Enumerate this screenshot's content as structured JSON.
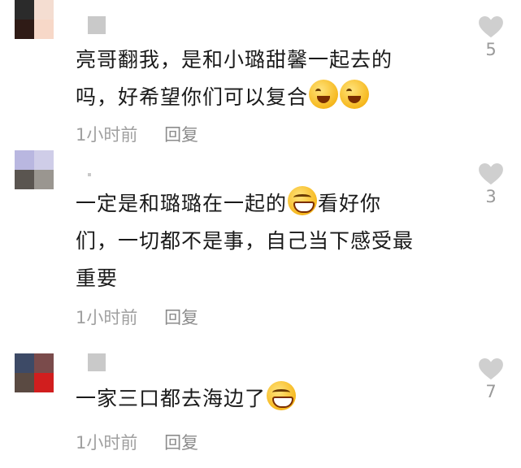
{
  "comments": [
    {
      "text_lines": [
        "亮哥翻我，是和小璐甜馨一起去的",
        "吗，好希望你们可以复合"
      ],
      "emoji": [
        "wink-laugh-emoji",
        "wink-laugh-emoji"
      ],
      "time": "1小时前",
      "reply": "回复",
      "likes": "5",
      "avatar_colors": [
        "#2b2b2b",
        "#f4ddd1",
        "#2f1b16",
        "#f7d8c8"
      ]
    },
    {
      "text_lines": [
        "一定是和璐璐在一起的",
        "看好你",
        "们，一切都不是事，自己当下感受最",
        "重要"
      ],
      "emoji": [
        "grin-emoji"
      ],
      "time": "1小时前",
      "reply": "回复",
      "likes": "3",
      "avatar_colors": [
        "#b9b7e0",
        "#cfcde8",
        "#5a5550",
        "#9a9690"
      ]
    },
    {
      "text_lines": [
        "一家三口都去海边了"
      ],
      "emoji": [
        "grin-emoji"
      ],
      "time": "1小时前",
      "reply": "回复",
      "likes": "7",
      "avatar_colors": [
        "#3d4a66",
        "#7a4b4b",
        "#5a4a42",
        "#d11e1e"
      ]
    }
  ],
  "colors": {
    "heart": "#cfcfcf",
    "meta_text": "#a0a0a0",
    "body_text": "#1a1a1a"
  }
}
